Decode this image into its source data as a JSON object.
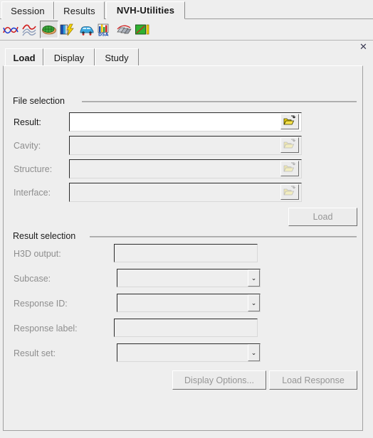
{
  "window": {
    "close_label": "✕"
  },
  "top_tabs": [
    {
      "label": "Session",
      "selected": false
    },
    {
      "label": "Results",
      "selected": false
    },
    {
      "label": "NVH-Utilities",
      "selected": true
    }
  ],
  "toolbar": {
    "buttons": [
      {
        "icon": "curve-red-blue-icon",
        "name": "frf-curves-button",
        "pressed": false
      },
      {
        "icon": "curve-stacked-icon",
        "name": "modal-curves-button",
        "pressed": false
      },
      {
        "icon": "green-cavity-icon",
        "name": "cavity-mesh-button",
        "pressed": true
      },
      {
        "icon": "panel-lightning-icon",
        "name": "panel-contribution-button",
        "pressed": false
      },
      {
        "icon": "blue-car-icon",
        "name": "vehicle-model-button",
        "pressed": false
      },
      {
        "icon": "dsa-bars-icon",
        "name": "dsa-button",
        "pressed": false
      },
      {
        "icon": "grey-panels-icon",
        "name": "panels-button",
        "pressed": false
      },
      {
        "icon": "green-plot-icon",
        "name": "plot-button",
        "pressed": false
      }
    ]
  },
  "sub_tabs": [
    {
      "label": "Load",
      "selected": true
    },
    {
      "label": "Display",
      "selected": false
    },
    {
      "label": "Study",
      "selected": false
    }
  ],
  "file_selection": {
    "group_label": "File selection",
    "rows": [
      {
        "label": "Result:",
        "value": "",
        "enabled": true,
        "browse_icon": "folder-open-icon"
      },
      {
        "label": "Cavity:",
        "value": "",
        "enabled": false,
        "browse_icon": "folder-open-icon"
      },
      {
        "label": "Structure:",
        "value": "",
        "enabled": false,
        "browse_icon": "folder-open-icon"
      },
      {
        "label": "Interface:",
        "value": "",
        "enabled": false,
        "browse_icon": "folder-open-icon"
      }
    ],
    "load_button": {
      "label": "Load",
      "enabled": false
    }
  },
  "result_selection": {
    "group_label": "Result selection",
    "rows": [
      {
        "label": "H3D output:",
        "type": "text",
        "value": "",
        "enabled": false
      },
      {
        "label": "Subcase:",
        "type": "combo",
        "value": "",
        "enabled": false
      },
      {
        "label": "Response ID:",
        "type": "combo",
        "value": "",
        "enabled": false
      },
      {
        "label": "Response label:",
        "type": "text",
        "value": "",
        "enabled": false
      },
      {
        "label": "Result set:",
        "type": "combo",
        "value": "",
        "enabled": false
      }
    ],
    "buttons": [
      {
        "label": "Display Options...",
        "name": "display-options-button",
        "enabled": false
      },
      {
        "label": "Load Response",
        "name": "load-response-button",
        "enabled": false
      }
    ],
    "combo_arrow": "⌄"
  },
  "colors": {
    "face": "#eeeeee",
    "field": "#ffffff",
    "disabled_text": "#8e8e8e",
    "border_dark": "#2b2b2b"
  }
}
